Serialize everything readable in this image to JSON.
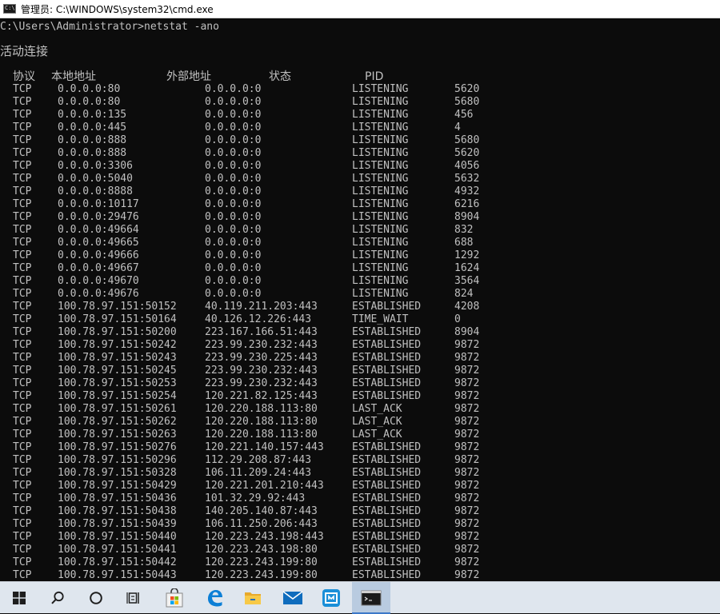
{
  "window": {
    "title": "管理员: C:\\WINDOWS\\system32\\cmd.exe",
    "icon_label": "C:\\"
  },
  "console": {
    "command_line": "C:\\Users\\Administrator>netstat -ano",
    "section_title": "活动连接",
    "headers": {
      "proto": "协议",
      "local": "本地地址",
      "foreign": "外部地址",
      "state": "状态",
      "pid": "PID"
    },
    "rows": [
      {
        "proto": "TCP",
        "local": "0.0.0.0:80",
        "foreign": "0.0.0.0:0",
        "state": "LISTENING",
        "pid": "5620"
      },
      {
        "proto": "TCP",
        "local": "0.0.0.0:80",
        "foreign": "0.0.0.0:0",
        "state": "LISTENING",
        "pid": "5680"
      },
      {
        "proto": "TCP",
        "local": "0.0.0.0:135",
        "foreign": "0.0.0.0:0",
        "state": "LISTENING",
        "pid": "456"
      },
      {
        "proto": "TCP",
        "local": "0.0.0.0:445",
        "foreign": "0.0.0.0:0",
        "state": "LISTENING",
        "pid": "4"
      },
      {
        "proto": "TCP",
        "local": "0.0.0.0:888",
        "foreign": "0.0.0.0:0",
        "state": "LISTENING",
        "pid": "5680"
      },
      {
        "proto": "TCP",
        "local": "0.0.0.0:888",
        "foreign": "0.0.0.0:0",
        "state": "LISTENING",
        "pid": "5620"
      },
      {
        "proto": "TCP",
        "local": "0.0.0.0:3306",
        "foreign": "0.0.0.0:0",
        "state": "LISTENING",
        "pid": "4056"
      },
      {
        "proto": "TCP",
        "local": "0.0.0.0:5040",
        "foreign": "0.0.0.0:0",
        "state": "LISTENING",
        "pid": "5632"
      },
      {
        "proto": "TCP",
        "local": "0.0.0.0:8888",
        "foreign": "0.0.0.0:0",
        "state": "LISTENING",
        "pid": "4932"
      },
      {
        "proto": "TCP",
        "local": "0.0.0.0:10117",
        "foreign": "0.0.0.0:0",
        "state": "LISTENING",
        "pid": "6216"
      },
      {
        "proto": "TCP",
        "local": "0.0.0.0:29476",
        "foreign": "0.0.0.0:0",
        "state": "LISTENING",
        "pid": "8904"
      },
      {
        "proto": "TCP",
        "local": "0.0.0.0:49664",
        "foreign": "0.0.0.0:0",
        "state": "LISTENING",
        "pid": "832"
      },
      {
        "proto": "TCP",
        "local": "0.0.0.0:49665",
        "foreign": "0.0.0.0:0",
        "state": "LISTENING",
        "pid": "688"
      },
      {
        "proto": "TCP",
        "local": "0.0.0.0:49666",
        "foreign": "0.0.0.0:0",
        "state": "LISTENING",
        "pid": "1292"
      },
      {
        "proto": "TCP",
        "local": "0.0.0.0:49667",
        "foreign": "0.0.0.0:0",
        "state": "LISTENING",
        "pid": "1624"
      },
      {
        "proto": "TCP",
        "local": "0.0.0.0:49670",
        "foreign": "0.0.0.0:0",
        "state": "LISTENING",
        "pid": "3564"
      },
      {
        "proto": "TCP",
        "local": "0.0.0.0:49676",
        "foreign": "0.0.0.0:0",
        "state": "LISTENING",
        "pid": "824"
      },
      {
        "proto": "TCP",
        "local": "100.78.97.151:50152",
        "foreign": "40.119.211.203:443",
        "state": "ESTABLISHED",
        "pid": "4208"
      },
      {
        "proto": "TCP",
        "local": "100.78.97.151:50164",
        "foreign": "40.126.12.226:443",
        "state": "TIME_WAIT",
        "pid": "0"
      },
      {
        "proto": "TCP",
        "local": "100.78.97.151:50200",
        "foreign": "223.167.166.51:443",
        "state": "ESTABLISHED",
        "pid": "8904"
      },
      {
        "proto": "TCP",
        "local": "100.78.97.151:50242",
        "foreign": "223.99.230.232:443",
        "state": "ESTABLISHED",
        "pid": "9872"
      },
      {
        "proto": "TCP",
        "local": "100.78.97.151:50243",
        "foreign": "223.99.230.225:443",
        "state": "ESTABLISHED",
        "pid": "9872"
      },
      {
        "proto": "TCP",
        "local": "100.78.97.151:50245",
        "foreign": "223.99.230.232:443",
        "state": "ESTABLISHED",
        "pid": "9872"
      },
      {
        "proto": "TCP",
        "local": "100.78.97.151:50253",
        "foreign": "223.99.230.232:443",
        "state": "ESTABLISHED",
        "pid": "9872"
      },
      {
        "proto": "TCP",
        "local": "100.78.97.151:50254",
        "foreign": "120.221.82.125:443",
        "state": "ESTABLISHED",
        "pid": "9872"
      },
      {
        "proto": "TCP",
        "local": "100.78.97.151:50261",
        "foreign": "120.220.188.113:80",
        "state": "LAST_ACK",
        "pid": "9872"
      },
      {
        "proto": "TCP",
        "local": "100.78.97.151:50262",
        "foreign": "120.220.188.113:80",
        "state": "LAST_ACK",
        "pid": "9872"
      },
      {
        "proto": "TCP",
        "local": "100.78.97.151:50263",
        "foreign": "120.220.188.113:80",
        "state": "LAST_ACK",
        "pid": "9872"
      },
      {
        "proto": "TCP",
        "local": "100.78.97.151:50276",
        "foreign": "120.221.140.157:443",
        "state": "ESTABLISHED",
        "pid": "9872"
      },
      {
        "proto": "TCP",
        "local": "100.78.97.151:50296",
        "foreign": "112.29.208.87:443",
        "state": "ESTABLISHED",
        "pid": "9872"
      },
      {
        "proto": "TCP",
        "local": "100.78.97.151:50328",
        "foreign": "106.11.209.24:443",
        "state": "ESTABLISHED",
        "pid": "9872"
      },
      {
        "proto": "TCP",
        "local": "100.78.97.151:50429",
        "foreign": "120.221.201.210:443",
        "state": "ESTABLISHED",
        "pid": "9872"
      },
      {
        "proto": "TCP",
        "local": "100.78.97.151:50436",
        "foreign": "101.32.29.92:443",
        "state": "ESTABLISHED",
        "pid": "9872"
      },
      {
        "proto": "TCP",
        "local": "100.78.97.151:50438",
        "foreign": "140.205.140.87:443",
        "state": "ESTABLISHED",
        "pid": "9872"
      },
      {
        "proto": "TCP",
        "local": "100.78.97.151:50439",
        "foreign": "106.11.250.206:443",
        "state": "ESTABLISHED",
        "pid": "9872"
      },
      {
        "proto": "TCP",
        "local": "100.78.97.151:50440",
        "foreign": "120.223.243.198:443",
        "state": "ESTABLISHED",
        "pid": "9872"
      },
      {
        "proto": "TCP",
        "local": "100.78.97.151:50441",
        "foreign": "120.223.243.198:80",
        "state": "ESTABLISHED",
        "pid": "9872"
      },
      {
        "proto": "TCP",
        "local": "100.78.97.151:50442",
        "foreign": "120.223.243.199:80",
        "state": "ESTABLISHED",
        "pid": "9872"
      },
      {
        "proto": "TCP",
        "local": "100.78.97.151:50443",
        "foreign": "120.223.243.199:80",
        "state": "ESTABLISHED",
        "pid": "9872"
      }
    ]
  },
  "taskbar": {
    "items": [
      {
        "name": "windows-start-icon",
        "accent": "#1e1e1e"
      },
      {
        "name": "search-icon",
        "accent": "#1e1e1e"
      },
      {
        "name": "cortana-icon",
        "accent": "#1e1e1e"
      },
      {
        "name": "task-view-icon",
        "accent": "#1e1e1e"
      },
      {
        "name": "store-icon",
        "accent": "#0078d4"
      },
      {
        "name": "edge-icon",
        "accent": "#0c7fd6"
      },
      {
        "name": "file-explorer-icon",
        "accent": "#f4c13d"
      },
      {
        "name": "mail-icon",
        "accent": "#0f6cbd"
      },
      {
        "name": "maxthon-icon",
        "accent": "#1a8fd8"
      },
      {
        "name": "cmd-icon",
        "accent": "#1a1a1a"
      }
    ]
  }
}
